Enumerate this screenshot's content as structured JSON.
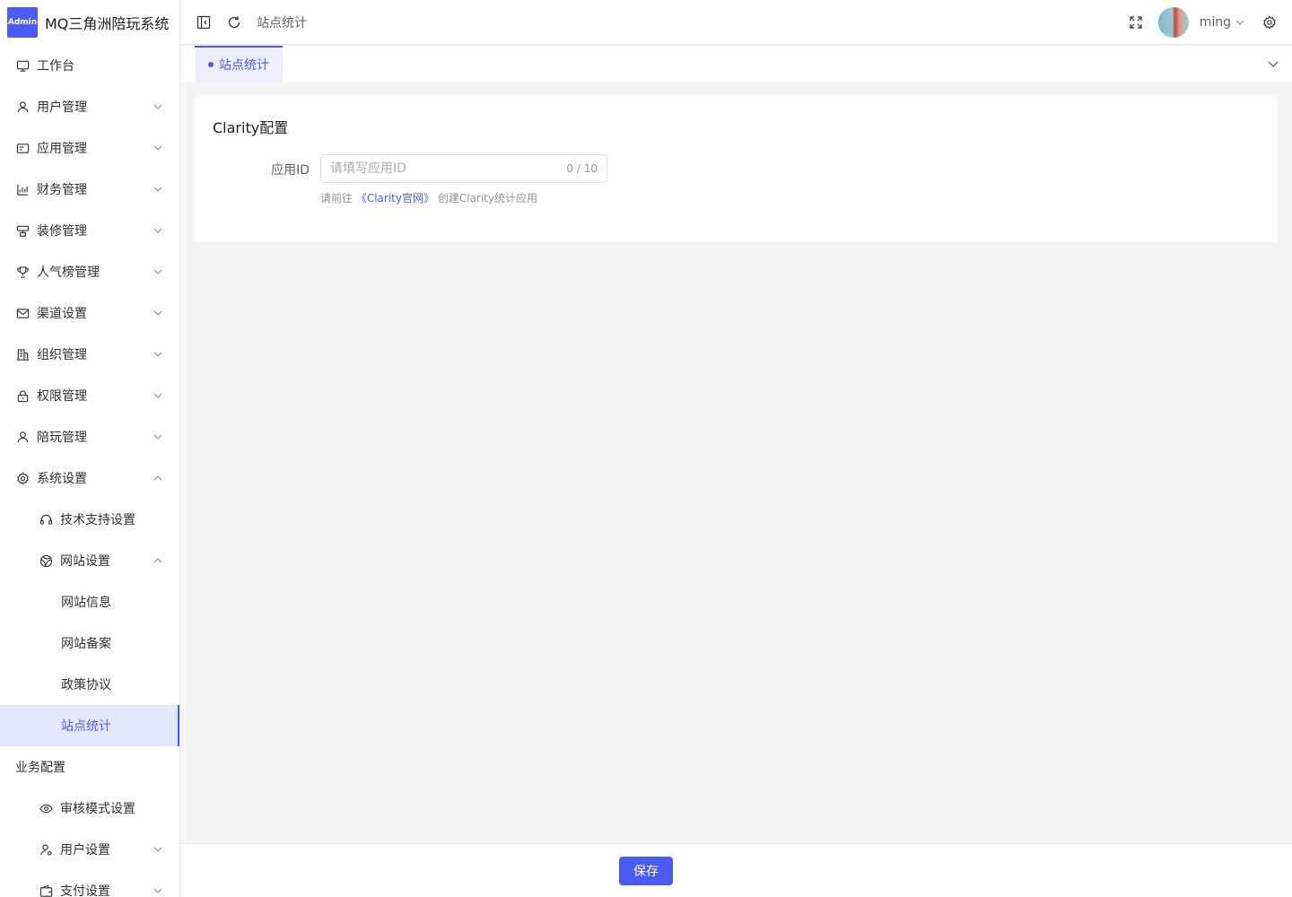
{
  "app": {
    "logo_text": "Admin",
    "title": "MQ三角洲陪玩系统"
  },
  "sidebar": {
    "items": [
      {
        "label": "工作台",
        "icon": "monitor-icon"
      },
      {
        "label": "用户管理",
        "icon": "user-icon"
      },
      {
        "label": "应用管理",
        "icon": "app-card-icon"
      },
      {
        "label": "财务管理",
        "icon": "chart-icon"
      },
      {
        "label": "装修管理",
        "icon": "decoration-icon"
      },
      {
        "label": "人气榜管理",
        "icon": "trophy-icon"
      },
      {
        "label": "渠道设置",
        "icon": "mail-icon"
      },
      {
        "label": "组织管理",
        "icon": "building-icon"
      },
      {
        "label": "权限管理",
        "icon": "lock-icon"
      },
      {
        "label": "陪玩管理",
        "icon": "user-icon"
      },
      {
        "label": "系统设置",
        "icon": "gear-icon"
      },
      {
        "label": "技术支持设置",
        "icon": "headset-icon"
      },
      {
        "label": "网站设置",
        "icon": "globe-icon"
      },
      {
        "label": "网站信息"
      },
      {
        "label": "网站备案"
      },
      {
        "label": "政策协议"
      },
      {
        "label": "站点统计"
      },
      {
        "label": "业务配置"
      },
      {
        "label": "审核模式设置",
        "icon": "eye-icon"
      },
      {
        "label": "用户设置",
        "icon": "user-settings-icon"
      },
      {
        "label": "支付设置",
        "icon": "wallet-icon"
      }
    ]
  },
  "header": {
    "breadcrumb": "站点统计",
    "username": "ming"
  },
  "tabs": [
    {
      "label": "站点统计"
    }
  ],
  "card": {
    "title": "Clarity配置",
    "app_id_label": "应用ID",
    "app_id_value": "",
    "app_id_placeholder": "请填写应用ID",
    "counter": "0 / 10",
    "hint_prefix": "请前往",
    "hint_link": "《Clarity官网》",
    "hint_suffix": "创建Clarity统计应用"
  },
  "footer": {
    "save_label": "保存"
  },
  "colors": {
    "accent": "#4a5cf2",
    "active_bg": "#e5e8fd",
    "page_bg": "#f5f5f5"
  }
}
